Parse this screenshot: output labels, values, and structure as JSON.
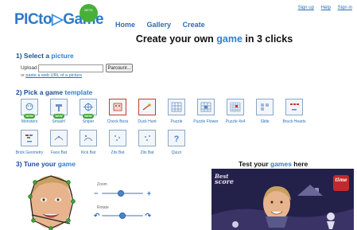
{
  "header": {
    "logo_text": "PICto",
    "logo_accent": "Game",
    "badge_text": "BETA",
    "nav": [
      "Home",
      "Gallery",
      "Create"
    ],
    "top_links": [
      "Sign up",
      "Help",
      "Sign in"
    ]
  },
  "headline": {
    "before": "Create your own ",
    "accent": "game",
    "after": " in 3 clicks"
  },
  "step1": {
    "title_prefix": "1) Select a ",
    "title_accent": "picture",
    "upload_label": "Upload",
    "upload_value": "",
    "browse_label": "Parcourir...",
    "url_prefix": "or ",
    "url_link": "paste a web URL of a picture"
  },
  "step2": {
    "title_prefix": "2) Pick a game ",
    "title_accent": "template",
    "new_badge": "NEW",
    "templates": [
      {
        "label": "Monsters",
        "new": true
      },
      {
        "label": "Smash!",
        "new": true
      },
      {
        "label": "Sniper",
        "new": true
      },
      {
        "label": "Check Boss",
        "new": false
      },
      {
        "label": "Duck Hunt",
        "new": false
      },
      {
        "label": "Puzzle",
        "new": false
      },
      {
        "label": "Puzzle Flower",
        "new": false
      },
      {
        "label": "Puzzle 4x4",
        "new": false
      },
      {
        "label": "Slide",
        "new": false
      },
      {
        "label": "Bruck Hearts",
        "new": false
      },
      {
        "label": "Brick Geometry",
        "new": false
      },
      {
        "label": "Face Bat",
        "new": false
      },
      {
        "label": "Kick Bat",
        "new": false
      },
      {
        "label": "Zits Bat",
        "new": false
      },
      {
        "label": "Zits Bat",
        "new": false
      },
      {
        "label": "Quizz",
        "new": false
      }
    ]
  },
  "step3": {
    "title_prefix": "3) Tune your ",
    "title_accent": "game",
    "zoom_label": "Zoom",
    "zoom_level": 0.45,
    "rotate_label": "Rotate",
    "rotate_level": 0.5
  },
  "test": {
    "title_prefix": "Test your ",
    "title_accent": "games",
    "title_suffix": " here",
    "hud_best": "Best",
    "hud_score": "score",
    "hud_time": "time"
  },
  "colors": {
    "brand_blue": "#2e7fd6",
    "nav_blue": "#2a6fb8",
    "new_green": "#3ea635"
  }
}
